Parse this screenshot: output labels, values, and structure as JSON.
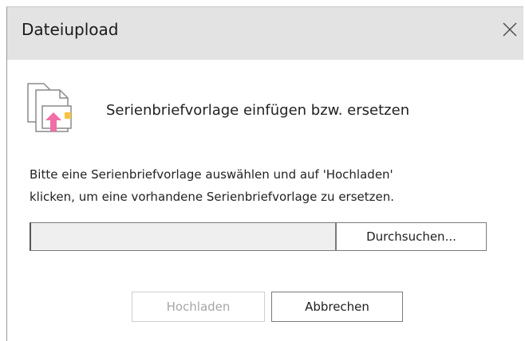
{
  "dialog": {
    "title": "Dateiupload",
    "close_icon": "close-icon"
  },
  "header": {
    "icon": "file-upload-icon",
    "icon_accent": "#ef6fa6",
    "icon_badge": "#f6c342",
    "text": "Serienbriefvorlage einfügen bzw. ersetzen"
  },
  "description": {
    "line1": "Bitte eine Serienbriefvorlage auswählen und auf 'Hochladen'",
    "line2": "klicken, um eine vorhandene Serienbriefvorlage zu ersetzen."
  },
  "file_input": {
    "value": "",
    "browse_label": "Durchsuchen..."
  },
  "actions": {
    "upload_label": "Hochladen",
    "upload_enabled": false,
    "cancel_label": "Abbrechen"
  }
}
